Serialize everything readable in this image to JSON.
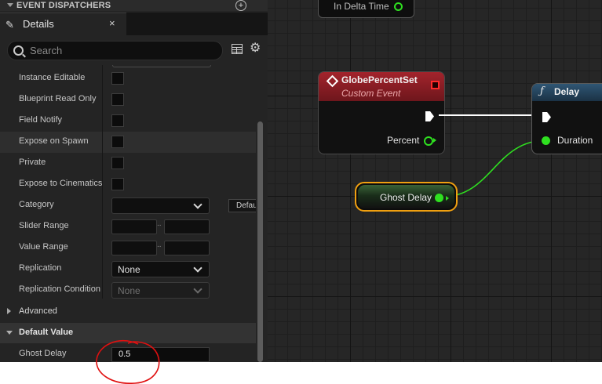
{
  "event_dispatchers": {
    "label": "EVENT DISPATCHERS",
    "add_icon": "plus-circle-icon"
  },
  "details_tab": {
    "title": "Details",
    "close": "×",
    "icon": "pencil-icon"
  },
  "search": {
    "placeholder": "Search"
  },
  "properties": [
    {
      "label": "Instance Editable",
      "type": "checkbox",
      "checked": false
    },
    {
      "label": "Blueprint Read Only",
      "type": "checkbox",
      "checked": false
    },
    {
      "label": "Field Notify",
      "type": "checkbox",
      "checked": false
    },
    {
      "label": "Expose on Spawn",
      "type": "checkbox",
      "checked": false
    },
    {
      "label": "Private",
      "type": "checkbox",
      "checked": false
    },
    {
      "label": "Expose to Cinematics",
      "type": "checkbox",
      "checked": false
    },
    {
      "label": "Category",
      "type": "dropdown",
      "value": "Default"
    },
    {
      "label": "Slider Range",
      "type": "range",
      "separator": ".."
    },
    {
      "label": "Value Range",
      "type": "range",
      "separator": ".."
    },
    {
      "label": "Replication",
      "type": "dropdown",
      "value": "None"
    },
    {
      "label": "Replication Condition",
      "type": "dropdown",
      "value": "None",
      "disabled": true
    }
  ],
  "sections": {
    "advanced": {
      "label": "Advanced",
      "expanded": false
    },
    "default_value": {
      "label": "Default Value",
      "expanded": true
    }
  },
  "default_value": {
    "label": "Ghost Delay",
    "value": "0.5"
  },
  "graph": {
    "top_node_label": "In Delta Time",
    "event_node": {
      "title": "GlobePercentSet",
      "subtitle": "Custom Event",
      "output_pin": "Percent"
    },
    "delay_node": {
      "icon": "ƒ",
      "title": "Delay",
      "input_pin": "Duration"
    },
    "variable_node": {
      "label": "Ghost Delay"
    }
  },
  "colors": {
    "event_header": "#a3242c",
    "function_header": "#2f5674",
    "float_pin": "#2fe020",
    "selection_outline": "#f0a010",
    "annotation": "#e01010"
  }
}
